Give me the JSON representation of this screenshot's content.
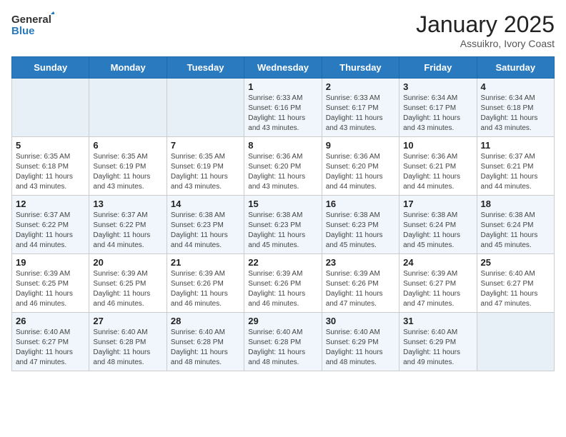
{
  "header": {
    "logo_general": "General",
    "logo_blue": "Blue",
    "month": "January 2025",
    "location": "Assuikro, Ivory Coast"
  },
  "weekdays": [
    "Sunday",
    "Monday",
    "Tuesday",
    "Wednesday",
    "Thursday",
    "Friday",
    "Saturday"
  ],
  "weeks": [
    [
      {
        "day": "",
        "info": ""
      },
      {
        "day": "",
        "info": ""
      },
      {
        "day": "",
        "info": ""
      },
      {
        "day": "1",
        "info": "Sunrise: 6:33 AM\nSunset: 6:16 PM\nDaylight: 11 hours\nand 43 minutes."
      },
      {
        "day": "2",
        "info": "Sunrise: 6:33 AM\nSunset: 6:17 PM\nDaylight: 11 hours\nand 43 minutes."
      },
      {
        "day": "3",
        "info": "Sunrise: 6:34 AM\nSunset: 6:17 PM\nDaylight: 11 hours\nand 43 minutes."
      },
      {
        "day": "4",
        "info": "Sunrise: 6:34 AM\nSunset: 6:18 PM\nDaylight: 11 hours\nand 43 minutes."
      }
    ],
    [
      {
        "day": "5",
        "info": "Sunrise: 6:35 AM\nSunset: 6:18 PM\nDaylight: 11 hours\nand 43 minutes."
      },
      {
        "day": "6",
        "info": "Sunrise: 6:35 AM\nSunset: 6:19 PM\nDaylight: 11 hours\nand 43 minutes."
      },
      {
        "day": "7",
        "info": "Sunrise: 6:35 AM\nSunset: 6:19 PM\nDaylight: 11 hours\nand 43 minutes."
      },
      {
        "day": "8",
        "info": "Sunrise: 6:36 AM\nSunset: 6:20 PM\nDaylight: 11 hours\nand 43 minutes."
      },
      {
        "day": "9",
        "info": "Sunrise: 6:36 AM\nSunset: 6:20 PM\nDaylight: 11 hours\nand 44 minutes."
      },
      {
        "day": "10",
        "info": "Sunrise: 6:36 AM\nSunset: 6:21 PM\nDaylight: 11 hours\nand 44 minutes."
      },
      {
        "day": "11",
        "info": "Sunrise: 6:37 AM\nSunset: 6:21 PM\nDaylight: 11 hours\nand 44 minutes."
      }
    ],
    [
      {
        "day": "12",
        "info": "Sunrise: 6:37 AM\nSunset: 6:22 PM\nDaylight: 11 hours\nand 44 minutes."
      },
      {
        "day": "13",
        "info": "Sunrise: 6:37 AM\nSunset: 6:22 PM\nDaylight: 11 hours\nand 44 minutes."
      },
      {
        "day": "14",
        "info": "Sunrise: 6:38 AM\nSunset: 6:23 PM\nDaylight: 11 hours\nand 44 minutes."
      },
      {
        "day": "15",
        "info": "Sunrise: 6:38 AM\nSunset: 6:23 PM\nDaylight: 11 hours\nand 45 minutes."
      },
      {
        "day": "16",
        "info": "Sunrise: 6:38 AM\nSunset: 6:23 PM\nDaylight: 11 hours\nand 45 minutes."
      },
      {
        "day": "17",
        "info": "Sunrise: 6:38 AM\nSunset: 6:24 PM\nDaylight: 11 hours\nand 45 minutes."
      },
      {
        "day": "18",
        "info": "Sunrise: 6:38 AM\nSunset: 6:24 PM\nDaylight: 11 hours\nand 45 minutes."
      }
    ],
    [
      {
        "day": "19",
        "info": "Sunrise: 6:39 AM\nSunset: 6:25 PM\nDaylight: 11 hours\nand 46 minutes."
      },
      {
        "day": "20",
        "info": "Sunrise: 6:39 AM\nSunset: 6:25 PM\nDaylight: 11 hours\nand 46 minutes."
      },
      {
        "day": "21",
        "info": "Sunrise: 6:39 AM\nSunset: 6:26 PM\nDaylight: 11 hours\nand 46 minutes."
      },
      {
        "day": "22",
        "info": "Sunrise: 6:39 AM\nSunset: 6:26 PM\nDaylight: 11 hours\nand 46 minutes."
      },
      {
        "day": "23",
        "info": "Sunrise: 6:39 AM\nSunset: 6:26 PM\nDaylight: 11 hours\nand 47 minutes."
      },
      {
        "day": "24",
        "info": "Sunrise: 6:39 AM\nSunset: 6:27 PM\nDaylight: 11 hours\nand 47 minutes."
      },
      {
        "day": "25",
        "info": "Sunrise: 6:40 AM\nSunset: 6:27 PM\nDaylight: 11 hours\nand 47 minutes."
      }
    ],
    [
      {
        "day": "26",
        "info": "Sunrise: 6:40 AM\nSunset: 6:27 PM\nDaylight: 11 hours\nand 47 minutes."
      },
      {
        "day": "27",
        "info": "Sunrise: 6:40 AM\nSunset: 6:28 PM\nDaylight: 11 hours\nand 48 minutes."
      },
      {
        "day": "28",
        "info": "Sunrise: 6:40 AM\nSunset: 6:28 PM\nDaylight: 11 hours\nand 48 minutes."
      },
      {
        "day": "29",
        "info": "Sunrise: 6:40 AM\nSunset: 6:28 PM\nDaylight: 11 hours\nand 48 minutes."
      },
      {
        "day": "30",
        "info": "Sunrise: 6:40 AM\nSunset: 6:29 PM\nDaylight: 11 hours\nand 48 minutes."
      },
      {
        "day": "31",
        "info": "Sunrise: 6:40 AM\nSunset: 6:29 PM\nDaylight: 11 hours\nand 49 minutes."
      },
      {
        "day": "",
        "info": ""
      }
    ]
  ]
}
